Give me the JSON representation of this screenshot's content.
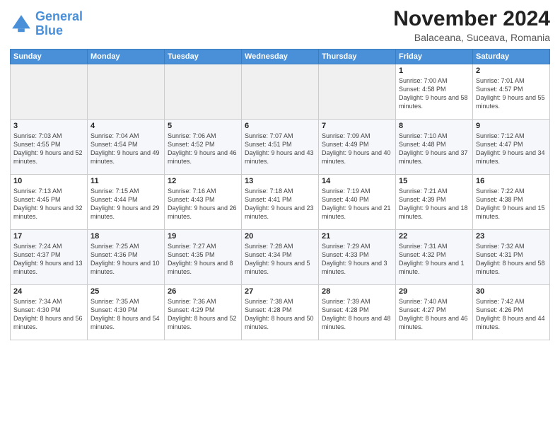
{
  "header": {
    "logo_line1": "General",
    "logo_line2": "Blue",
    "month_title": "November 2024",
    "location": "Balaceana, Suceava, Romania"
  },
  "weekdays": [
    "Sunday",
    "Monday",
    "Tuesday",
    "Wednesday",
    "Thursday",
    "Friday",
    "Saturday"
  ],
  "weeks": [
    [
      {
        "day": "",
        "info": ""
      },
      {
        "day": "",
        "info": ""
      },
      {
        "day": "",
        "info": ""
      },
      {
        "day": "",
        "info": ""
      },
      {
        "day": "",
        "info": ""
      },
      {
        "day": "1",
        "info": "Sunrise: 7:00 AM\nSunset: 4:58 PM\nDaylight: 9 hours and 58 minutes."
      },
      {
        "day": "2",
        "info": "Sunrise: 7:01 AM\nSunset: 4:57 PM\nDaylight: 9 hours and 55 minutes."
      }
    ],
    [
      {
        "day": "3",
        "info": "Sunrise: 7:03 AM\nSunset: 4:55 PM\nDaylight: 9 hours and 52 minutes."
      },
      {
        "day": "4",
        "info": "Sunrise: 7:04 AM\nSunset: 4:54 PM\nDaylight: 9 hours and 49 minutes."
      },
      {
        "day": "5",
        "info": "Sunrise: 7:06 AM\nSunset: 4:52 PM\nDaylight: 9 hours and 46 minutes."
      },
      {
        "day": "6",
        "info": "Sunrise: 7:07 AM\nSunset: 4:51 PM\nDaylight: 9 hours and 43 minutes."
      },
      {
        "day": "7",
        "info": "Sunrise: 7:09 AM\nSunset: 4:49 PM\nDaylight: 9 hours and 40 minutes."
      },
      {
        "day": "8",
        "info": "Sunrise: 7:10 AM\nSunset: 4:48 PM\nDaylight: 9 hours and 37 minutes."
      },
      {
        "day": "9",
        "info": "Sunrise: 7:12 AM\nSunset: 4:47 PM\nDaylight: 9 hours and 34 minutes."
      }
    ],
    [
      {
        "day": "10",
        "info": "Sunrise: 7:13 AM\nSunset: 4:45 PM\nDaylight: 9 hours and 32 minutes."
      },
      {
        "day": "11",
        "info": "Sunrise: 7:15 AM\nSunset: 4:44 PM\nDaylight: 9 hours and 29 minutes."
      },
      {
        "day": "12",
        "info": "Sunrise: 7:16 AM\nSunset: 4:43 PM\nDaylight: 9 hours and 26 minutes."
      },
      {
        "day": "13",
        "info": "Sunrise: 7:18 AM\nSunset: 4:41 PM\nDaylight: 9 hours and 23 minutes."
      },
      {
        "day": "14",
        "info": "Sunrise: 7:19 AM\nSunset: 4:40 PM\nDaylight: 9 hours and 21 minutes."
      },
      {
        "day": "15",
        "info": "Sunrise: 7:21 AM\nSunset: 4:39 PM\nDaylight: 9 hours and 18 minutes."
      },
      {
        "day": "16",
        "info": "Sunrise: 7:22 AM\nSunset: 4:38 PM\nDaylight: 9 hours and 15 minutes."
      }
    ],
    [
      {
        "day": "17",
        "info": "Sunrise: 7:24 AM\nSunset: 4:37 PM\nDaylight: 9 hours and 13 minutes."
      },
      {
        "day": "18",
        "info": "Sunrise: 7:25 AM\nSunset: 4:36 PM\nDaylight: 9 hours and 10 minutes."
      },
      {
        "day": "19",
        "info": "Sunrise: 7:27 AM\nSunset: 4:35 PM\nDaylight: 9 hours and 8 minutes."
      },
      {
        "day": "20",
        "info": "Sunrise: 7:28 AM\nSunset: 4:34 PM\nDaylight: 9 hours and 5 minutes."
      },
      {
        "day": "21",
        "info": "Sunrise: 7:29 AM\nSunset: 4:33 PM\nDaylight: 9 hours and 3 minutes."
      },
      {
        "day": "22",
        "info": "Sunrise: 7:31 AM\nSunset: 4:32 PM\nDaylight: 9 hours and 1 minute."
      },
      {
        "day": "23",
        "info": "Sunrise: 7:32 AM\nSunset: 4:31 PM\nDaylight: 8 hours and 58 minutes."
      }
    ],
    [
      {
        "day": "24",
        "info": "Sunrise: 7:34 AM\nSunset: 4:30 PM\nDaylight: 8 hours and 56 minutes."
      },
      {
        "day": "25",
        "info": "Sunrise: 7:35 AM\nSunset: 4:30 PM\nDaylight: 8 hours and 54 minutes."
      },
      {
        "day": "26",
        "info": "Sunrise: 7:36 AM\nSunset: 4:29 PM\nDaylight: 8 hours and 52 minutes."
      },
      {
        "day": "27",
        "info": "Sunrise: 7:38 AM\nSunset: 4:28 PM\nDaylight: 8 hours and 50 minutes."
      },
      {
        "day": "28",
        "info": "Sunrise: 7:39 AM\nSunset: 4:28 PM\nDaylight: 8 hours and 48 minutes."
      },
      {
        "day": "29",
        "info": "Sunrise: 7:40 AM\nSunset: 4:27 PM\nDaylight: 8 hours and 46 minutes."
      },
      {
        "day": "30",
        "info": "Sunrise: 7:42 AM\nSunset: 4:26 PM\nDaylight: 8 hours and 44 minutes."
      }
    ]
  ]
}
